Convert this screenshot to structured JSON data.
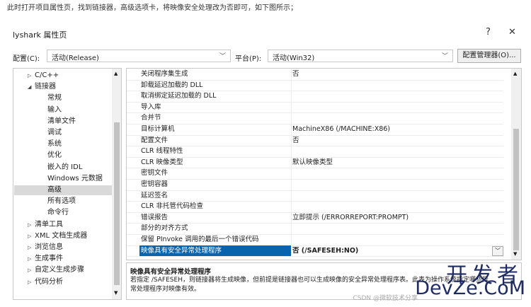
{
  "intro_text": "此时打开项目属性页，找到链接器，高级选项卡，将映像安全处理改为否即可，如下图所示；",
  "dialog": {
    "title": "lyshark 属性页",
    "help": "?",
    "close": "✕"
  },
  "config": {
    "label": "配置(C):",
    "value": "活动(Release)",
    "platform_label": "平台(P):",
    "platform_value": "活动(Win32)",
    "manager_button": "配置管理器(O)..."
  },
  "tree": [
    {
      "label": "C/C++",
      "expander": "▷",
      "indent": 0
    },
    {
      "label": "链接器",
      "expander": "◢",
      "indent": 0
    },
    {
      "label": "常规",
      "expander": "",
      "indent": 2
    },
    {
      "label": "输入",
      "expander": "",
      "indent": 2
    },
    {
      "label": "清单文件",
      "expander": "",
      "indent": 2
    },
    {
      "label": "调试",
      "expander": "",
      "indent": 2
    },
    {
      "label": "系统",
      "expander": "",
      "indent": 2
    },
    {
      "label": "优化",
      "expander": "",
      "indent": 2
    },
    {
      "label": "嵌入的 IDL",
      "expander": "",
      "indent": 2
    },
    {
      "label": "Windows 元数据",
      "expander": "",
      "indent": 2
    },
    {
      "label": "高级",
      "expander": "",
      "indent": 2,
      "selected": true
    },
    {
      "label": "所有选项",
      "expander": "",
      "indent": 2
    },
    {
      "label": "命令行",
      "expander": "",
      "indent": 2
    },
    {
      "label": "清单工具",
      "expander": "▷",
      "indent": 0
    },
    {
      "label": "XML 文档生成器",
      "expander": "▷",
      "indent": 0
    },
    {
      "label": "浏览信息",
      "expander": "▷",
      "indent": 0
    },
    {
      "label": "生成事件",
      "expander": "▷",
      "indent": 0
    },
    {
      "label": "自定义生成步骤",
      "expander": "▷",
      "indent": 0
    },
    {
      "label": "代码分析",
      "expander": "▷",
      "indent": 0
    }
  ],
  "properties": [
    {
      "name": "关闭程序集生成",
      "value": "否"
    },
    {
      "name": "卸载延迟加载的 DLL",
      "value": ""
    },
    {
      "name": "取消绑定延迟加载的 DLL",
      "value": ""
    },
    {
      "name": "导入库",
      "value": ""
    },
    {
      "name": "合并节",
      "value": ""
    },
    {
      "name": "目标计算机",
      "value": "MachineX86 (/MACHINE:X86)"
    },
    {
      "name": "配置文件",
      "value": "否"
    },
    {
      "name": "CLR 线程特性",
      "value": ""
    },
    {
      "name": "CLR 映像类型",
      "value": "默认映像类型"
    },
    {
      "name": "密钥文件",
      "value": ""
    },
    {
      "name": "密钥容器",
      "value": ""
    },
    {
      "name": "延迟签名",
      "value": ""
    },
    {
      "name": "CLR 非托管代码检查",
      "value": ""
    },
    {
      "name": "错误报告",
      "value": "立即提示 (/ERRORREPORT:PROMPT)"
    },
    {
      "name": "部分的对齐方式",
      "value": ""
    },
    {
      "name": "保留 PInvoke 调用的最后一个错误代码",
      "value": ""
    },
    {
      "name": "映像具有安全异常处理程序",
      "value": "否 (/SAFESEH:NO)",
      "selected": true
    }
  ],
  "description": {
    "heading": "映像具有安全异常处理程序",
    "text": "若指定 /SAFESEH，则链接器将生成映像，但前提是链接器也可以生成映像的安全异常处理程序表。此表为操作系统指定哪些异常处理程序对映像有效。"
  },
  "watermark": {
    "line1": "开发者",
    "line2": "DevZe.CoM",
    "line3": "CSDN @微软技术分享"
  },
  "icons": {
    "expand": "chevron-right-icon",
    "collapse": "chevron-down-icon",
    "dropdown": "chevron-down-icon",
    "scroll_up": "caret-up-icon",
    "scroll_down": "caret-down-icon"
  }
}
